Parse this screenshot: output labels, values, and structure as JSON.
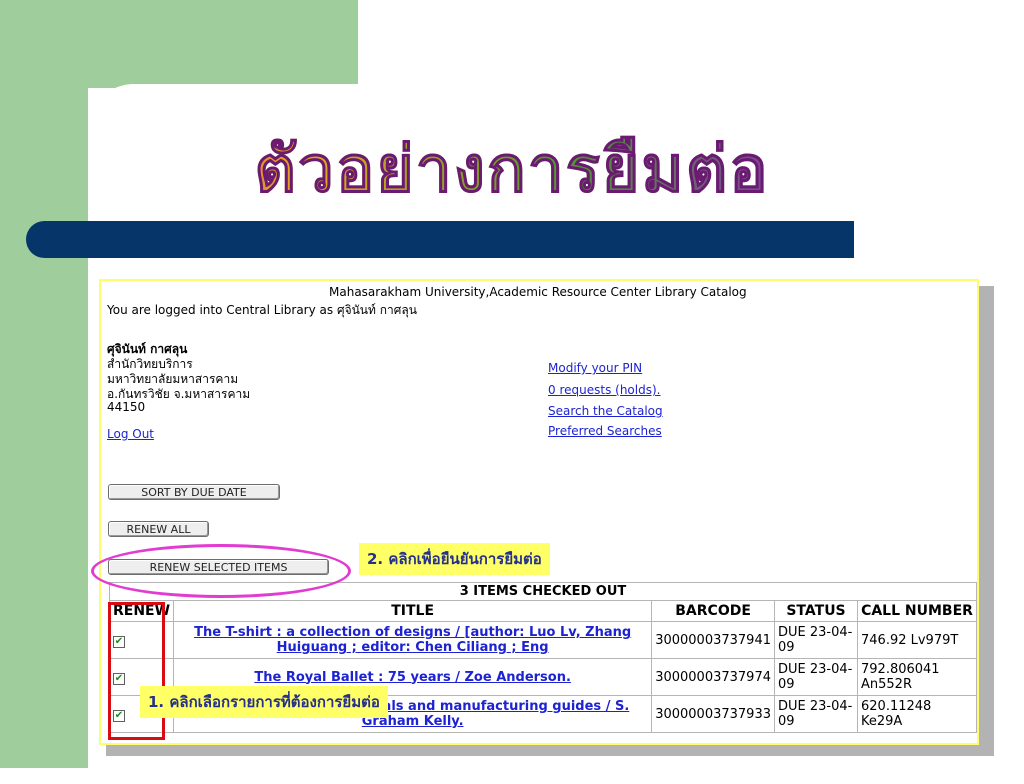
{
  "slide": {
    "title": "ตัวอย่างการยืมต่อ",
    "colors": {
      "green": "#9fce9c",
      "navy": "#053569",
      "annotation_bg": "#ffff66",
      "annotation_text": "#24308c",
      "highlight_pink": "#e23bd2",
      "highlight_red": "#d90c14"
    }
  },
  "catalog": {
    "header": "Mahasarakham University,Academic Resource Center Library Catalog",
    "logged_in": "You are logged into Central Library as ศุจินันท์ กาศลุน",
    "patron": {
      "name": "ศุจินันท์ กาศลุน",
      "address_lines": [
        "สำนักวิทยบริการ",
        "มหาวิทยาลัยมหาสารคาม",
        "อ.กันทรวิชัย จ.มหาสารคาม",
        "44150"
      ],
      "logout": "Log Out"
    },
    "links": [
      "Modify your PIN",
      "0 requests (holds).",
      "Search the Catalog",
      "Preferred Searches"
    ],
    "buttons": {
      "sort": "SORT BY DUE DATE",
      "renew_all": "RENEW ALL",
      "renew_selected": "RENEW SELECTED ITEMS"
    },
    "table": {
      "caption": "3 ITEMS CHECKED OUT",
      "headers": [
        "RENEW",
        "TITLE",
        "BARCODE",
        "STATUS",
        "CALL NUMBER"
      ],
      "rows": [
        {
          "checked": true,
          "title": "The T-shirt : a collection of designs / [author: Luo Lv, Zhang Huiguang ; editor: Chen Ciliang ; Eng",
          "barcode": "30000003737941",
          "status": "DUE 23-04-09",
          "call": "746.92 Lv979T"
        },
        {
          "checked": true,
          "title": "The Royal Ballet : 75 years / Zoe Anderson.",
          "barcode": "30000003737974",
          "status": "DUE 23-04-09",
          "call": "792.806041 An552R"
        },
        {
          "checked": true,
          "title": "Industrial design : materials and manufacturing guides / S. Graham Kelly.",
          "barcode": "30000003737933",
          "status": "DUE 23-04-09",
          "call": "620.11248 Ke29A"
        }
      ]
    }
  },
  "annotations": {
    "step1": "1. คลิกเลือกรายการที่ต้องการยืมต่อ",
    "step2": "2. คลิกเพื่อยืนยันการยืมต่อ"
  }
}
